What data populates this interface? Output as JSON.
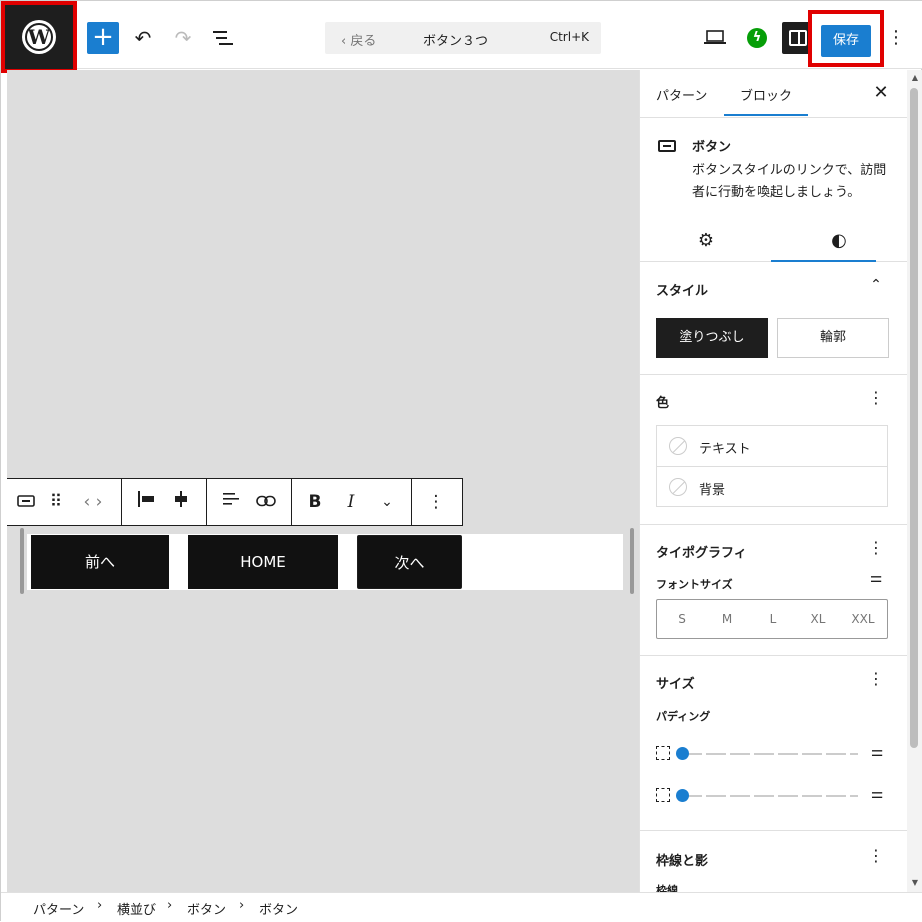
{
  "header": {
    "back_label": "戻る",
    "document_title": "ボタン３つ",
    "shortcut": "Ctrl+K",
    "save_label": "保存",
    "accent_color": "#1a7ed0",
    "highlight_color": "#e00000"
  },
  "canvas": {
    "buttons": [
      {
        "label": "前へ"
      },
      {
        "label": "HOME"
      },
      {
        "label": "次へ"
      }
    ]
  },
  "sidebar": {
    "tabs": [
      "パターン",
      "ブロック"
    ],
    "active_tab": "ブロック",
    "block_card": {
      "title": "ボタン",
      "description": "ボタンスタイルのリンクで、訪問者に行動を喚起しましょう。"
    },
    "sub_tabs": [
      "settings",
      "styles"
    ],
    "active_sub_tab": "styles",
    "style_section": {
      "title": "スタイル",
      "options": [
        "塗りつぶし",
        "輪郭"
      ],
      "selected": "塗りつぶし"
    },
    "color_section": {
      "title": "色",
      "items": [
        "テキスト",
        "背景"
      ]
    },
    "typography_section": {
      "title": "タイポグラフィ",
      "font_size_label": "フォントサイズ",
      "sizes": [
        "S",
        "M",
        "L",
        "XL",
        "XXL"
      ]
    },
    "size_section": {
      "title": "サイズ",
      "padding_label": "パディング",
      "padding_vertical": 0,
      "padding_horizontal": 0
    },
    "border_section": {
      "title": "枠線と影",
      "sub_label": "枠線"
    }
  },
  "breadcrumb": [
    "パターン",
    "横並び",
    "ボタン",
    "ボタン"
  ]
}
